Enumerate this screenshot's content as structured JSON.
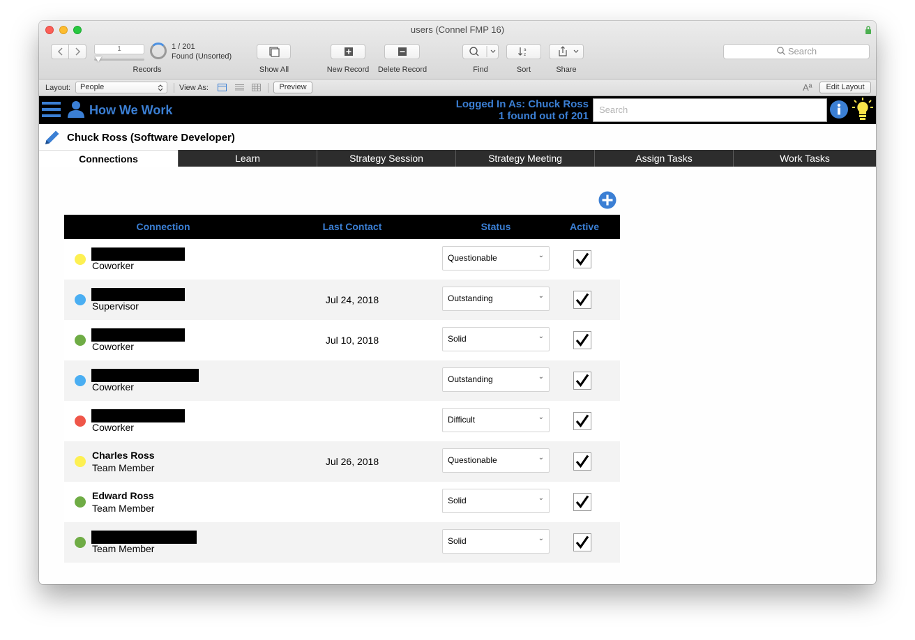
{
  "window": {
    "title": "users (Connel FMP 16)"
  },
  "toolbar": {
    "record_number": "1",
    "found_count": "1 / 201",
    "found_state": "Found (Unsorted)",
    "records_label": "Records",
    "show_all_label": "Show All",
    "new_record_label": "New Record",
    "delete_record_label": "Delete Record",
    "find_label": "Find",
    "sort_label": "Sort",
    "share_label": "Share",
    "search_placeholder": "Search"
  },
  "layoutbar": {
    "layout_label": "Layout:",
    "layout_value": "People",
    "view_as_label": "View As:",
    "preview_label": "Preview",
    "edit_layout_label": "Edit Layout"
  },
  "header": {
    "app_title": "How We Work",
    "logged_in": "Logged In As: Chuck Ross",
    "found_text": "1 found out of 201",
    "search_placeholder": "Search",
    "accent_color": "#3b7fd4"
  },
  "record": {
    "title": "Chuck Ross (Software Developer)"
  },
  "tabs": [
    {
      "label": "Connections"
    },
    {
      "label": "Learn"
    },
    {
      "label": "Strategy Session"
    },
    {
      "label": "Strategy Meeting"
    },
    {
      "label": "Assign Tasks"
    },
    {
      "label": "Work Tasks"
    }
  ],
  "table": {
    "headers": [
      "Connection",
      "Last Contact",
      "Status",
      "Active"
    ],
    "rows": [
      {
        "name": "",
        "role": "Coworker",
        "date": "",
        "status": "Questionable",
        "active": "✔",
        "dot": "#fdf052"
      },
      {
        "name": "",
        "role": "Supervisor",
        "date": "Jul 24, 2018",
        "status": "Outstanding",
        "active": "✔",
        "dot": "#4aaef2"
      },
      {
        "name": "",
        "role": "Coworker",
        "date": "Jul 10, 2018",
        "status": "Solid",
        "active": "✔",
        "dot": "#6fac45"
      },
      {
        "name": "",
        "role": "Coworker",
        "date": "",
        "status": "Outstanding",
        "active": "✔",
        "dot": "#4aaef2"
      },
      {
        "name": "",
        "role": "Coworker",
        "date": "",
        "status": "Difficult",
        "active": "✔",
        "dot": "#ef5649"
      },
      {
        "name": "Charles Ross",
        "role": "Team Member",
        "date": "Jul 26, 2018",
        "status": "Questionable",
        "active": "✔",
        "dot": "#fdf052"
      },
      {
        "name": "Edward Ross",
        "role": "Team Member",
        "date": "",
        "status": "Solid",
        "active": "✔",
        "dot": "#6fac45"
      },
      {
        "name": "",
        "role": "Team Member",
        "date": "",
        "status": "Solid",
        "active": "✔",
        "dot": "#6fac45"
      }
    ]
  }
}
